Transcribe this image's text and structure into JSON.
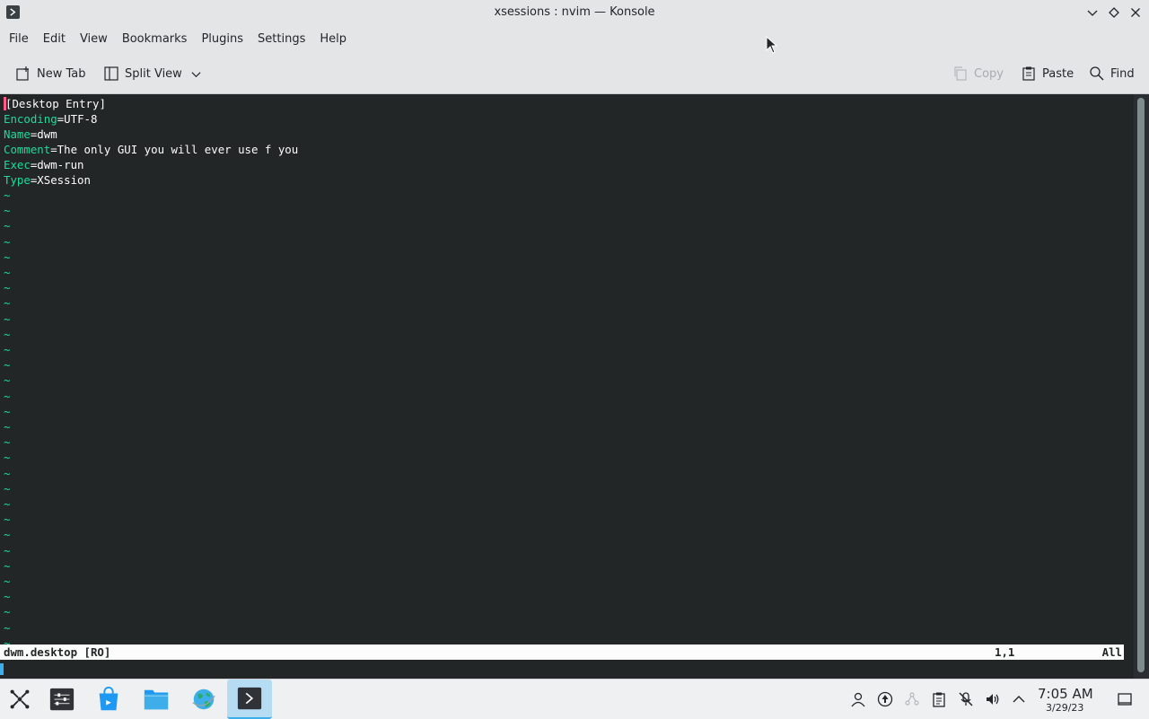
{
  "window": {
    "title": "xsessions : nvim — Konsole"
  },
  "menu": [
    "File",
    "Edit",
    "View",
    "Bookmarks",
    "Plugins",
    "Settings",
    "Help"
  ],
  "toolbar": {
    "new_tab": "New Tab",
    "split_view": "Split View",
    "copy": "Copy",
    "paste": "Paste",
    "find": "Find"
  },
  "editor": {
    "first_line_rest": "Desktop Entry]",
    "first_char": "[",
    "lines": [
      {
        "key": "Encoding",
        "value": "=UTF-8"
      },
      {
        "key": "Name",
        "value": "=dwm"
      },
      {
        "key": "Comment",
        "value": "=The only GUI you will ever use f you"
      },
      {
        "key": "Exec",
        "value": "=dwm-run"
      },
      {
        "key": "Type",
        "value": "=XSession"
      }
    ],
    "tilde": "~",
    "status_file": "dwm.desktop [RO]",
    "status_pos": "1,1",
    "status_pct": "All"
  },
  "taskbar": {
    "time": "7:05 AM",
    "date": "3/29/23"
  },
  "colors": {
    "terminal_bg": "#232627",
    "syntax_key": "#1cdc9a",
    "accent": "#3daee9"
  }
}
